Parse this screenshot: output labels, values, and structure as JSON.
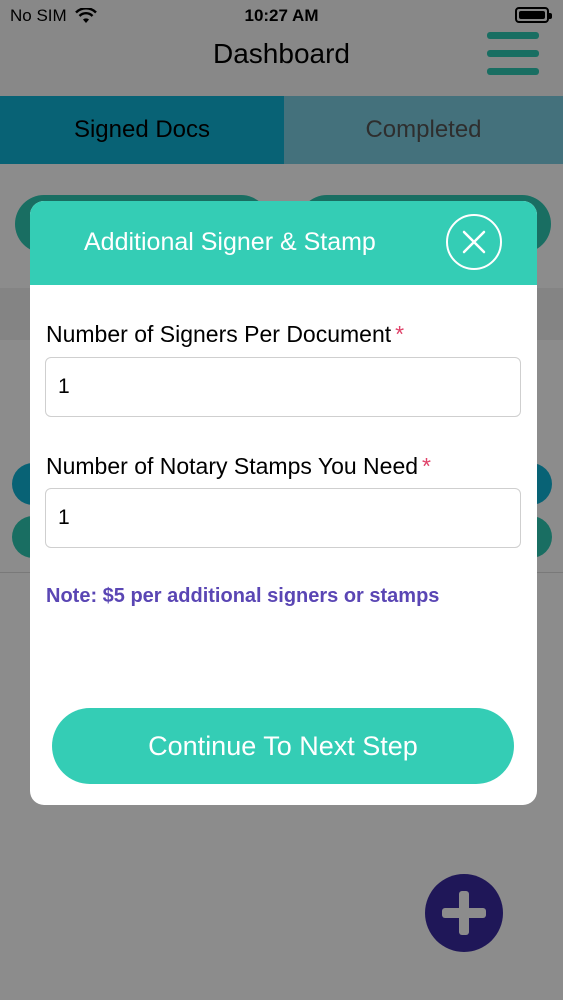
{
  "status_bar": {
    "carrier": "No SIM",
    "time": "10:27 AM",
    "icons": [
      "wifi-icon",
      "battery-icon"
    ]
  },
  "header": {
    "title": "Dashboard",
    "menu_icon": "hamburger-menu-icon"
  },
  "tabs": [
    {
      "label": "Signed Docs",
      "active": true
    },
    {
      "label": "Completed",
      "active": false
    }
  ],
  "modal": {
    "title": "Additional Signer & Stamp",
    "close_icon": "close-icon",
    "fields": [
      {
        "label": "Number of Signers Per Document",
        "required_marker": "*",
        "value": "1"
      },
      {
        "label": "Number of Notary Stamps You Need",
        "required_marker": "*",
        "value": "1"
      }
    ],
    "note": "Note: $5 per additional signers or stamps",
    "continue_label": "Continue To Next Step"
  },
  "fab_icon": "plus-icon",
  "colors": {
    "accent": "#34cdb5",
    "tab_active": "#10b3d6",
    "note_text": "#5a46b4",
    "required": "#e0436a",
    "fab": "#3a2aa0"
  }
}
